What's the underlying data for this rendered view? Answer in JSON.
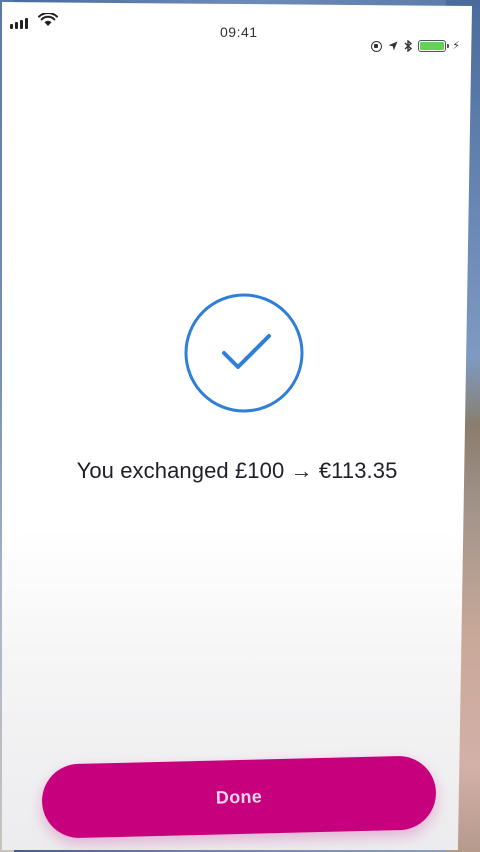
{
  "status_bar": {
    "time": "09:41",
    "battery_color": "#5fd35a"
  },
  "confirmation": {
    "icon": "checkmark-circle-icon",
    "icon_color": "#2f7fd6",
    "message": "You exchanged £100 → €113.35"
  },
  "actions": {
    "done_label": "Done",
    "done_color": "#c7007e"
  }
}
